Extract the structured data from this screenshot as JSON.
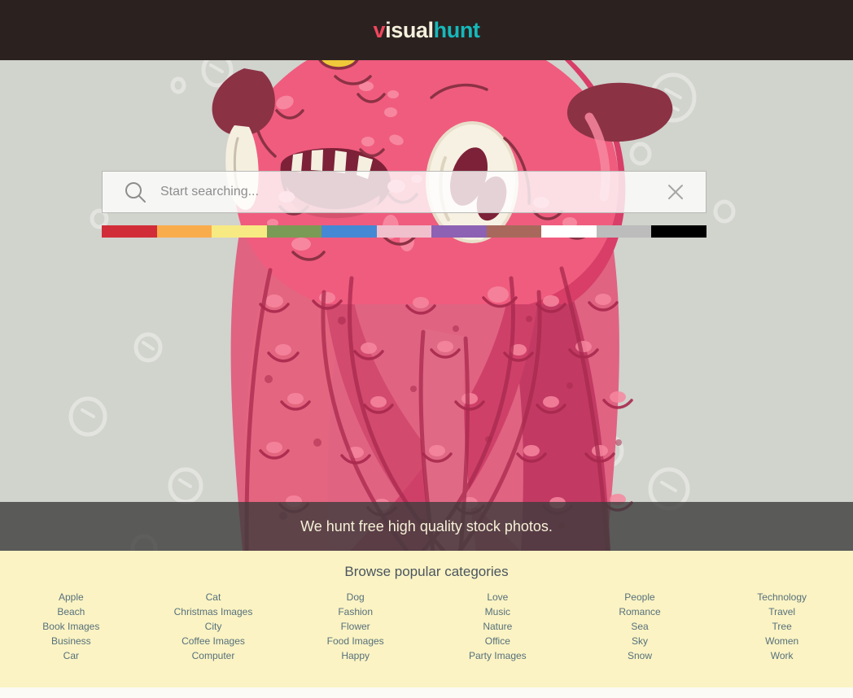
{
  "header": {
    "logo": {
      "part1": "v",
      "part2": "isual",
      "part3": "hunt"
    },
    "background_color": "#2b2220"
  },
  "search": {
    "placeholder": "Start searching...",
    "value": "",
    "search_icon": "search-icon",
    "clear_icon": "close-icon"
  },
  "color_filter": {
    "swatches": [
      {
        "name": "red",
        "hex": "#d12d38"
      },
      {
        "name": "orange",
        "hex": "#f9ac4c"
      },
      {
        "name": "yellow",
        "hex": "#f8ea83"
      },
      {
        "name": "green",
        "hex": "#7a9b55"
      },
      {
        "name": "blue",
        "hex": "#4589d4"
      },
      {
        "name": "pink",
        "hex": "#f0c0cd"
      },
      {
        "name": "purple",
        "hex": "#8d62b4"
      },
      {
        "name": "brown",
        "hex": "#a8695c"
      },
      {
        "name": "white",
        "hex": "#ffffff"
      },
      {
        "name": "gray",
        "hex": "#bcbcbc"
      },
      {
        "name": "black",
        "hex": "#000000"
      }
    ]
  },
  "tagline": {
    "text": "We hunt free high quality stock photos."
  },
  "categories": {
    "title": "Browse popular categories",
    "columns": [
      {
        "items": [
          "Apple",
          "Beach",
          "Book Images",
          "Business",
          "Car"
        ]
      },
      {
        "items": [
          "Cat",
          "Christmas Images",
          "City",
          "Coffee Images",
          "Computer"
        ]
      },
      {
        "items": [
          "Dog",
          "Fashion",
          "Flower",
          "Food Images",
          "Happy"
        ]
      },
      {
        "items": [
          "Love",
          "Music",
          "Nature",
          "Office",
          "Party Images"
        ]
      },
      {
        "items": [
          "People",
          "Romance",
          "Sea",
          "Sky",
          "Snow"
        ]
      },
      {
        "items": [
          "Technology",
          "Travel",
          "Tree",
          "Women",
          "Work"
        ]
      }
    ]
  },
  "hero": {
    "background_color": "#d1d3cd",
    "illustration": "pink-monster-illustration"
  }
}
